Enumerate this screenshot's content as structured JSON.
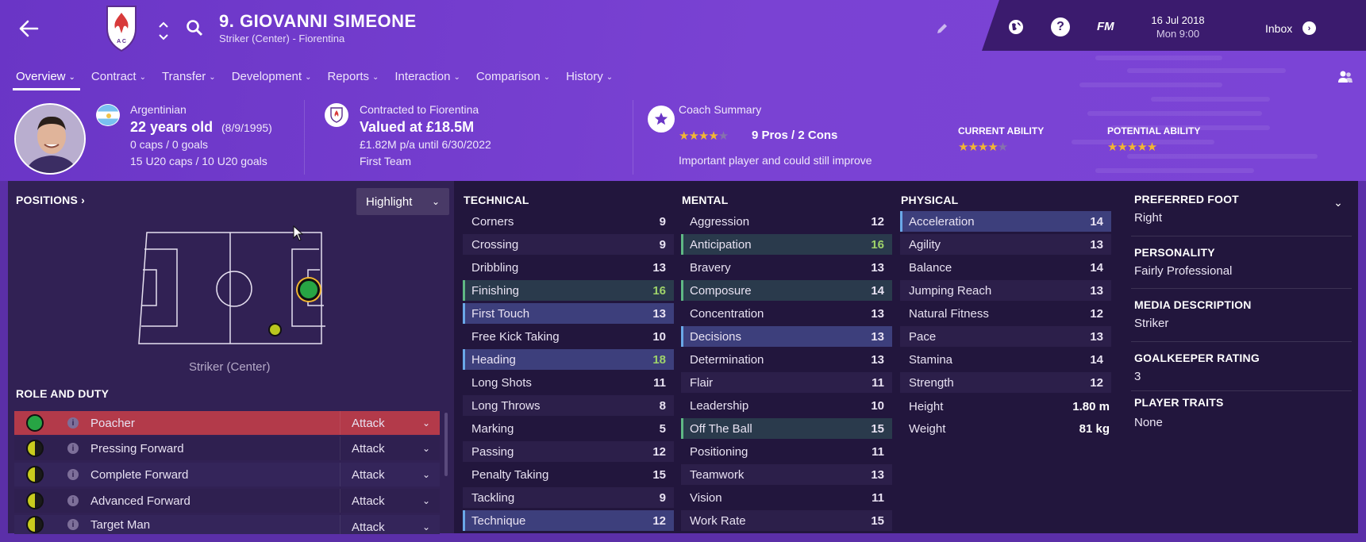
{
  "header": {
    "player_title": "9. GIOVANNI SIMEONE",
    "player_subtitle": "Striker (Center) - Fiorentina",
    "date": "16 Jul 2018",
    "time": "Mon 9:00",
    "fm_label": "FM",
    "inbox_label": "Inbox"
  },
  "tabs": [
    "Overview",
    "Contract",
    "Transfer",
    "Development",
    "Reports",
    "Interaction",
    "Comparison",
    "History"
  ],
  "bio": {
    "nationality": "Argentinian",
    "age": "22 years old",
    "dob": "(8/9/1995)",
    "caps": "0 caps / 0 goals",
    "u20": "15 U20 caps / 10 U20 goals"
  },
  "contract": {
    "club_line": "Contracted to Fiorentina",
    "value": "Valued at £18.5M",
    "wage": "£1.82M p/a until 6/30/2022",
    "squad": "First Team"
  },
  "coach": {
    "title": "Coach Summary",
    "pros_cons": "9 Pros / 2 Cons",
    "rating_stars": 3.5,
    "summary": "Important player and could still improve"
  },
  "ability": {
    "current_label": "CURRENT ABILITY",
    "current_stars": 3.5,
    "potential_label": "POTENTIAL ABILITY",
    "potential_stars": 4.5
  },
  "positions": {
    "heading": "POSITIONS",
    "highlight": "Highlight",
    "caption": "Striker (Center)"
  },
  "roles": {
    "heading": "ROLE AND DUTY",
    "items": [
      {
        "name": "Poacher",
        "duty": "Attack"
      },
      {
        "name": "Pressing Forward",
        "duty": "Attack"
      },
      {
        "name": "Complete Forward",
        "duty": "Attack"
      },
      {
        "name": "Advanced Forward",
        "duty": "Attack"
      },
      {
        "name": "Target Man",
        "duty": "Attack"
      }
    ]
  },
  "technical": {
    "heading": "TECHNICAL",
    "items": [
      {
        "name": "Corners",
        "value": "9"
      },
      {
        "name": "Crossing",
        "value": "9"
      },
      {
        "name": "Dribbling",
        "value": "13"
      },
      {
        "name": "Finishing",
        "value": "16"
      },
      {
        "name": "First Touch",
        "value": "13"
      },
      {
        "name": "Free Kick Taking",
        "value": "10"
      },
      {
        "name": "Heading",
        "value": "18"
      },
      {
        "name": "Long Shots",
        "value": "11"
      },
      {
        "name": "Long Throws",
        "value": "8"
      },
      {
        "name": "Marking",
        "value": "5"
      },
      {
        "name": "Passing",
        "value": "12"
      },
      {
        "name": "Penalty Taking",
        "value": "15"
      },
      {
        "name": "Tackling",
        "value": "9"
      },
      {
        "name": "Technique",
        "value": "12"
      }
    ]
  },
  "mental": {
    "heading": "MENTAL",
    "items": [
      {
        "name": "Aggression",
        "value": "12"
      },
      {
        "name": "Anticipation",
        "value": "16"
      },
      {
        "name": "Bravery",
        "value": "13"
      },
      {
        "name": "Composure",
        "value": "14"
      },
      {
        "name": "Concentration",
        "value": "13"
      },
      {
        "name": "Decisions",
        "value": "13"
      },
      {
        "name": "Determination",
        "value": "13"
      },
      {
        "name": "Flair",
        "value": "11"
      },
      {
        "name": "Leadership",
        "value": "10"
      },
      {
        "name": "Off The Ball",
        "value": "15"
      },
      {
        "name": "Positioning",
        "value": "11"
      },
      {
        "name": "Teamwork",
        "value": "13"
      },
      {
        "name": "Vision",
        "value": "11"
      },
      {
        "name": "Work Rate",
        "value": "15"
      }
    ]
  },
  "physical": {
    "heading": "PHYSICAL",
    "items": [
      {
        "name": "Acceleration",
        "value": "14"
      },
      {
        "name": "Agility",
        "value": "13"
      },
      {
        "name": "Balance",
        "value": "14"
      },
      {
        "name": "Jumping Reach",
        "value": "13"
      },
      {
        "name": "Natural Fitness",
        "value": "12"
      },
      {
        "name": "Pace",
        "value": "13"
      },
      {
        "name": "Stamina",
        "value": "14"
      },
      {
        "name": "Strength",
        "value": "12"
      }
    ],
    "height_label": "Height",
    "height": "1.80 m",
    "weight_label": "Weight",
    "weight": "81 kg"
  },
  "info": {
    "foot_label": "PREFERRED FOOT",
    "foot": "Right",
    "personality_label": "PERSONALITY",
    "personality": "Fairly Professional",
    "media_label": "MEDIA DESCRIPTION",
    "media": "Striker",
    "gk_label": "GOALKEEPER RATING",
    "gk": "3",
    "traits_label": "PLAYER TRAITS",
    "traits": "None"
  },
  "colors": {
    "header_purple": "#7a42d3",
    "panel_dark": "#22163d",
    "green_value": "#9ed36a",
    "role_selected": "#b33a4a"
  }
}
